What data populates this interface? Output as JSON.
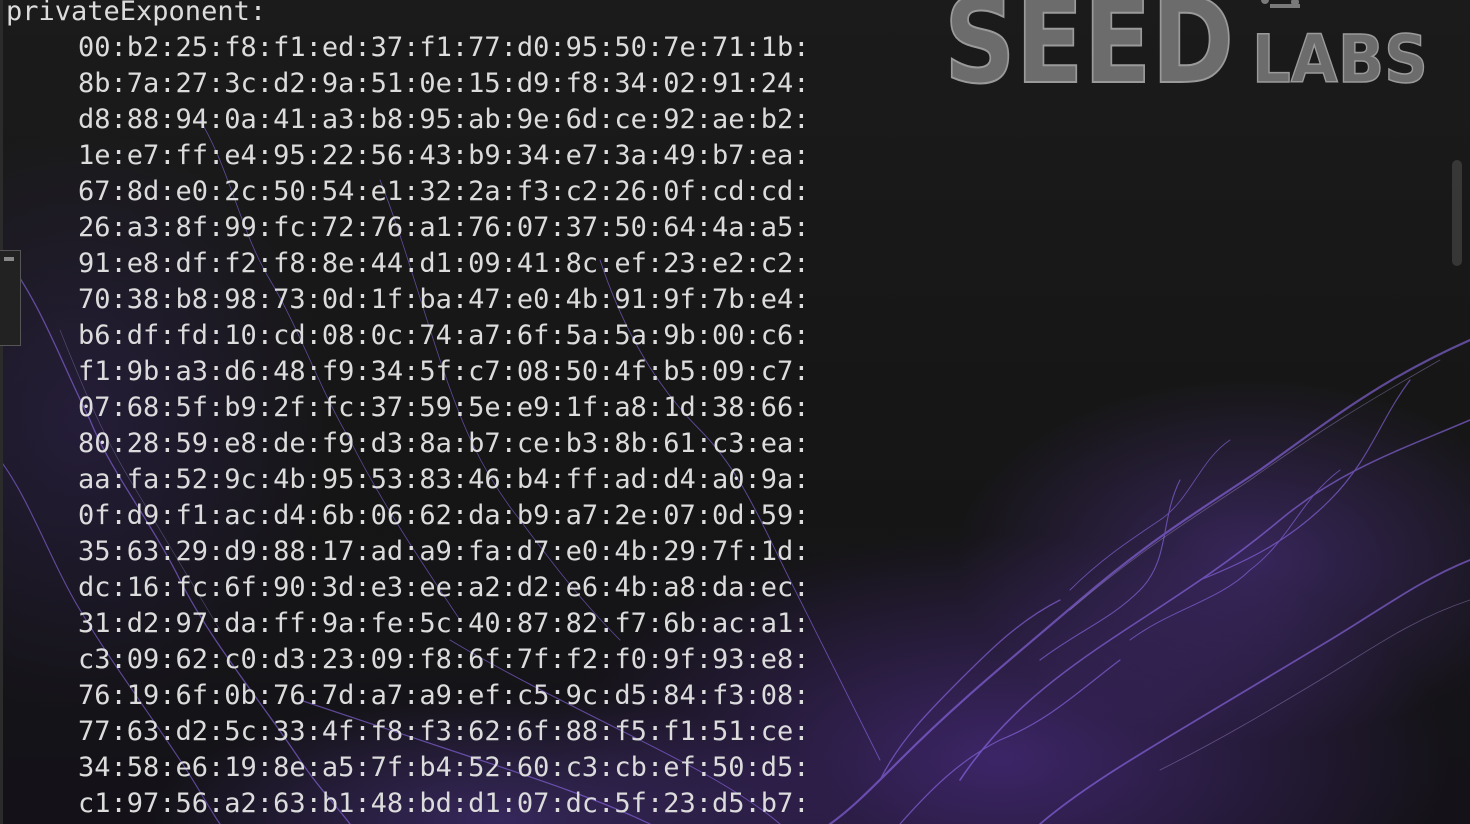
{
  "wallpaper": {
    "logo_main": "SEED",
    "logo_sub": "LABS",
    "accent": "#7a4fe0"
  },
  "terminal": {
    "label": "privateExponent:",
    "lines": [
      "00:b2:25:f8:f1:ed:37:f1:77:d0:95:50:7e:71:1b:",
      "8b:7a:27:3c:d2:9a:51:0e:15:d9:f8:34:02:91:24:",
      "d8:88:94:0a:41:a3:b8:95:ab:9e:6d:ce:92:ae:b2:",
      "1e:e7:ff:e4:95:22:56:43:b9:34:e7:3a:49:b7:ea:",
      "67:8d:e0:2c:50:54:e1:32:2a:f3:c2:26:0f:cd:cd:",
      "26:a3:8f:99:fc:72:76:a1:76:07:37:50:64:4a:a5:",
      "91:e8:df:f2:f8:8e:44:d1:09:41:8c:ef:23:e2:c2:",
      "70:38:b8:98:73:0d:1f:ba:47:e0:4b:91:9f:7b:e4:",
      "b6:df:fd:10:cd:08:0c:74:a7:6f:5a:5a:9b:00:c6:",
      "f1:9b:a3:d6:48:f9:34:5f:c7:08:50:4f:b5:09:c7:",
      "07:68:5f:b9:2f:fc:37:59:5e:e9:1f:a8:1d:38:66:",
      "80:28:59:e8:de:f9:d3:8a:b7:ce:b3:8b:61:c3:ea:",
      "aa:fa:52:9c:4b:95:53:83:46:b4:ff:ad:d4:a0:9a:",
      "0f:d9:f1:ac:d4:6b:06:62:da:b9:a7:2e:07:0d:59:",
      "35:63:29:d9:88:17:ad:a9:fa:d7:e0:4b:29:7f:1d:",
      "dc:16:fc:6f:90:3d:e3:ee:a2:d2:e6:4b:a8:da:ec:",
      "31:d2:97:da:ff:9a:fe:5c:40:87:82:f7:6b:ac:a1:",
      "c3:09:62:c0:d3:23:09:f8:6f:7f:f2:f0:9f:93:e8:",
      "76:19:6f:0b:76:7d:a7:a9:ef:c5:9c:d5:84:f3:08:",
      "77:63:d2:5c:33:4f:f8:f3:62:6f:88:f5:f1:51:ce:",
      "34:58:e6:19:8e:a5:7f:b4:52:60:c3:cb:ef:50:d5:",
      "c1:97:56:a2:63:b1:48:bd:d1:07:dc:5f:23:d5:b7:"
    ]
  }
}
